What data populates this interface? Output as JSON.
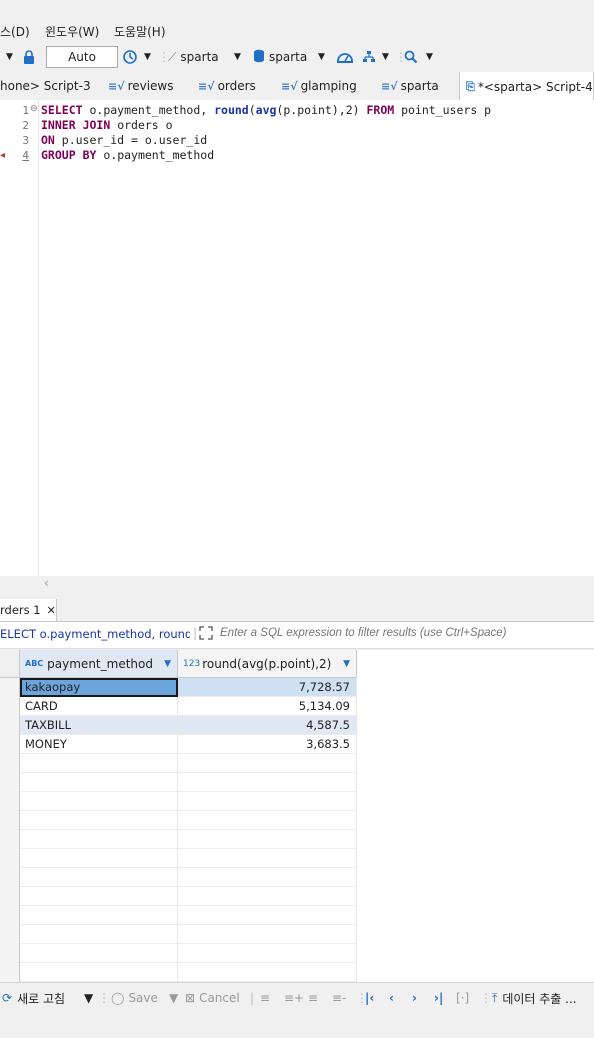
{
  "menu": {
    "items": [
      "스(D)",
      "윈도우(W)",
      "도움말(H)"
    ]
  },
  "toolbar": {
    "commit_mode": "Auto",
    "datasource_label": "sparta",
    "schema_label": "sparta"
  },
  "tabs": [
    {
      "label": "hone> Script-3",
      "active": false
    },
    {
      "label": "reviews",
      "active": false
    },
    {
      "label": "orders",
      "active": false
    },
    {
      "label": "glamping",
      "active": false
    },
    {
      "label": "sparta",
      "active": false
    },
    {
      "label": "*<sparta> Script-4",
      "active": true
    }
  ],
  "editor": {
    "line_numbers": [
      "1",
      "2",
      "3",
      "4"
    ],
    "lines": [
      "SELECT o.payment_method, round(avg(p.point),2) FROM point_users p",
      "INNER JOIN orders o",
      "ON p.user_id = o.user_id",
      "GROUP BY o.payment_method"
    ]
  },
  "results": {
    "tab_label": "rders 1",
    "filter_sql": "ELECT o.payment_method, round(av",
    "filter_placeholder": "Enter a SQL expression to filter results (use Ctrl+Space)",
    "columns": [
      {
        "type_badge": "ABC",
        "name": "payment_method"
      },
      {
        "type_badge": "123",
        "name": "round(avg(p.point),2)"
      }
    ],
    "rows": [
      [
        "kakaopay",
        "7,728.57"
      ],
      [
        "CARD",
        "5,134.09"
      ],
      [
        "TAXBILL",
        "4,587.5"
      ],
      [
        "MONEY",
        "3,683.5"
      ]
    ]
  },
  "bottom_toolbar": {
    "refresh_label": "새로 고침",
    "save_label": "Save",
    "cancel_label": "Cancel",
    "export_label": "데이터 추출 ..."
  },
  "colors": {
    "selected_cell": "#6aa5dc",
    "selected_row": "#cfe0f2",
    "alt_row": "#dfe8f3",
    "keyword": "#7f0055",
    "function": "#1a35a7"
  }
}
